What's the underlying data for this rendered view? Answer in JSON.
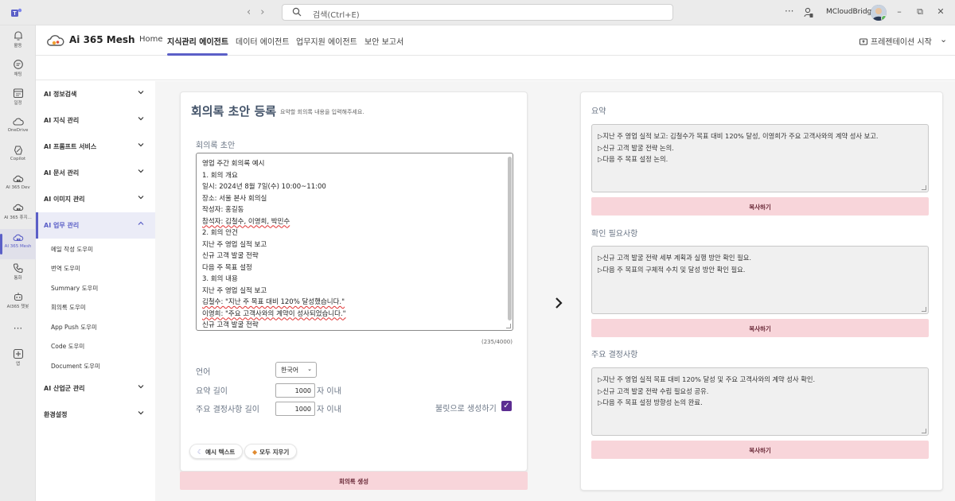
{
  "titlebar": {
    "search_placeholder": "검색(Ctrl+E)",
    "more_label": "···",
    "org_name": "MCloudBridge",
    "minimize": "–",
    "restore": "⧉",
    "close": "✕"
  },
  "rail": {
    "items": [
      {
        "label": "활동",
        "icon": "bell-icon"
      },
      {
        "label": "채팅",
        "icon": "chat-icon"
      },
      {
        "label": "일정",
        "icon": "calendar-icon"
      },
      {
        "label": "OneDrive",
        "icon": "cloud-icon"
      },
      {
        "label": "Copilot",
        "icon": "copilot-icon"
      },
      {
        "label": "AI 365 Dev",
        "icon": "cloud-app-icon"
      },
      {
        "label": "AI 365 휴지...",
        "icon": "cloud-app-icon"
      },
      {
        "label": "AI 365 Mesh",
        "icon": "cloud-app-icon"
      },
      {
        "label": "통화",
        "icon": "phone-icon"
      },
      {
        "label": "AI365 챗봇",
        "icon": "bot-icon"
      },
      {
        "label": "",
        "icon": "more-icon"
      },
      {
        "label": "앱",
        "icon": "plus-app-icon"
      }
    ],
    "more_label": "···",
    "active_index": 7
  },
  "header": {
    "brand": "Ai 365 Mesh",
    "tabs": [
      "Home",
      "지식관리 에이전트",
      "데이터 에이전트",
      "업무지원 에이전트",
      "보안 보고서"
    ],
    "active_tab": 1,
    "present_label": "프레젠테이션 시작",
    "chevron": "⌄"
  },
  "sidebar": {
    "items": [
      {
        "label": "AI 정보검색"
      },
      {
        "label": "AI 지식 관리"
      },
      {
        "label": "AI 프롬프트 서비스"
      },
      {
        "label": "AI 문서 관리"
      },
      {
        "label": "AI 이미지 관리"
      },
      {
        "label": "AI 업무 관리"
      },
      {
        "label": "AI 산업군 관리"
      },
      {
        "label": "환경설정"
      }
    ],
    "subitems": [
      "메일 작성 도우미",
      "번역 도우미",
      "Summary 도우미",
      "회의록 도우미",
      "App Push 도우미",
      "Code 도우미",
      "Document 도우미"
    ]
  },
  "form": {
    "title": "회의록 초안 등록",
    "hint": "요약할 회의록 내용을 입력해주세요.",
    "draft_label": "회의록 초안",
    "draft_lines": [
      "영업 주간 회의록 예시",
      "1. 회의 개요",
      "일시: 2024년 8월 7일(수) 10:00~11:00",
      "장소: 서울 본사 회의실",
      "작성자: 홍길동",
      "참석자: 김철수, 이영희, 박민수",
      "2. 회의 안건",
      "지난 주 영업 실적 보고",
      "신규 고객 발굴 전략",
      "다음 주 목표 설정",
      "3. 회의 내용",
      "지난 주 영업 실적 보고",
      "김철수: \"지난 주 목표 대비 120% 달성했습니다.\"",
      "이영희: \"주요 고객사와의 계약이 성사되었습니다.\"",
      "신규 고객 발굴 전략"
    ],
    "counter": "(235/4000)",
    "language_label": "언어",
    "language_value": "한국어",
    "summary_length_label": "요약 길이",
    "summary_length_value": "1000",
    "decision_length_label": "주요 결정사항 길이",
    "decision_length_value": "1000",
    "unit_label": "자 이내",
    "bullet_label": "불릿으로 생성하기",
    "bullet_checked": true,
    "example_btn": "예시 텍스트",
    "clear_btn": "모두 지우기",
    "generate_btn": "회의록 생성"
  },
  "output": {
    "sections": [
      {
        "title": "요약",
        "lines": [
          "▷지난 주 영업 실적 보고: 김철수가 목표 대비 120% 달성, 이영희가 주요 고객사와의 계약 성사 보고.",
          "▷신규 고객 발굴 전략 논의.",
          "▷다음 주 목표 설정 논의."
        ],
        "copy_label": "복사하기"
      },
      {
        "title": "확인 필요사항",
        "lines": [
          "▷신규 고객 발굴 전략 세부 계획과 실행 방안 확인 필요.",
          "▷다음 주 목표의 구체적 수치 및 달성 방안 확인 필요."
        ],
        "copy_label": "복사하기"
      },
      {
        "title": "주요 결정사항",
        "lines": [
          "▷지난 주 영업 실적 목표 대비 120% 달성 및 주요 고객사와의 계약 성사 확인.",
          "▷신규 고객 발굴 전략 수립 필요성 공유.",
          "▷다음 주 목표 설정 방향성 논의 완료."
        ],
        "copy_label": "복사하기"
      }
    ]
  },
  "colors": {
    "accent": "#5b5fc7",
    "button_pink": "#f8d5da",
    "checkbox": "#5c2d91"
  }
}
